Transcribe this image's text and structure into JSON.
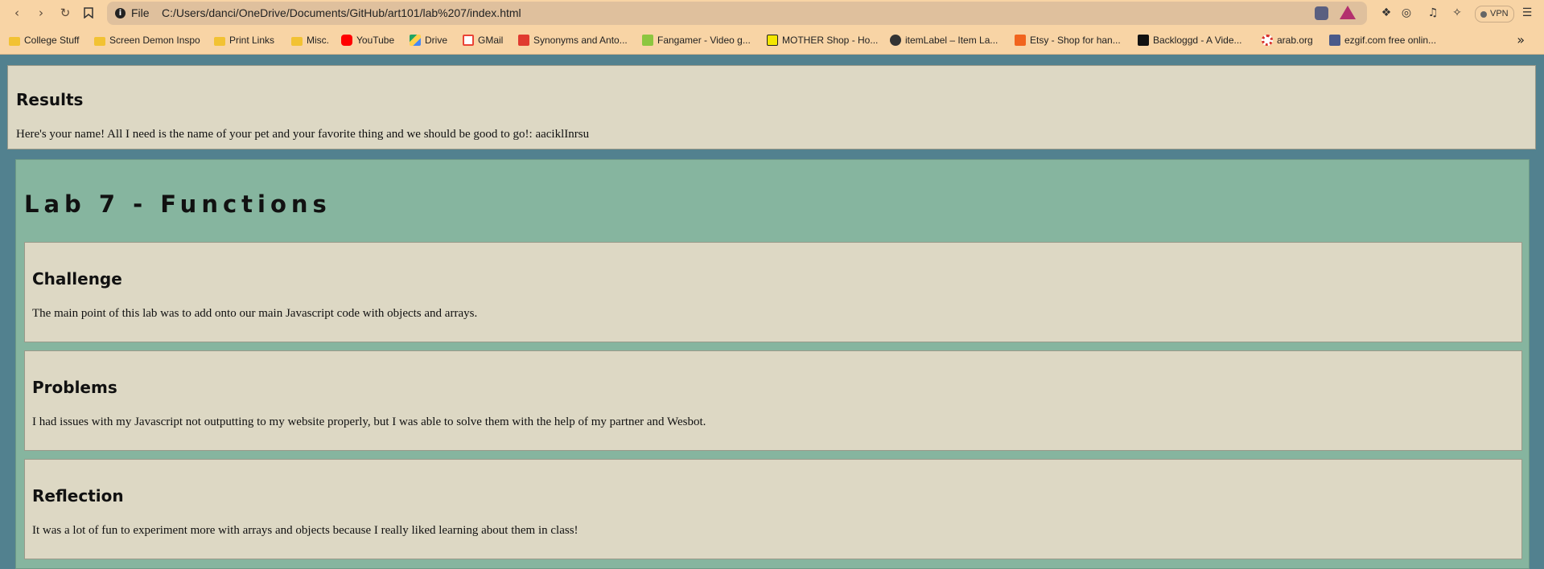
{
  "browser": {
    "file_label": "File",
    "url": "C:/Users/danci/OneDrive/Documents/GitHub/art101/lab%207/index.html",
    "vpn_label": "VPN"
  },
  "bookmarks": [
    {
      "label": "College Stuff",
      "icon": "folder-icon",
      "color": "#f2c233"
    },
    {
      "label": "Screen Demon Inspo",
      "icon": "folder-icon",
      "color": "#f2c233"
    },
    {
      "label": "Print Links",
      "icon": "folder-icon",
      "color": "#f2c233"
    },
    {
      "label": "Misc.",
      "icon": "folder-icon",
      "color": "#f2c233"
    },
    {
      "label": "YouTube",
      "icon": "youtube-icon",
      "color": "#ff0000"
    },
    {
      "label": "Drive",
      "icon": "drive-icon",
      "color": "#1fa463"
    },
    {
      "label": "GMail",
      "icon": "gmail-icon",
      "color": "#ea4335"
    },
    {
      "label": "Synonyms and Anto...",
      "icon": "thesaurus-icon",
      "color": "#e03a2f"
    },
    {
      "label": "Fangamer - Video g...",
      "icon": "fangamer-icon",
      "color": "#8cc63f"
    },
    {
      "label": "MOTHER Shop - Ho...",
      "icon": "mother-icon",
      "color": "#f3e600"
    },
    {
      "label": "itemLabel – Item La...",
      "icon": "globe-icon",
      "color": "#333333"
    },
    {
      "label": "Etsy - Shop for han...",
      "icon": "etsy-icon",
      "color": "#f1641e"
    },
    {
      "label": "Backloggd - A Vide...",
      "icon": "backloggd-icon",
      "color": "#111111"
    },
    {
      "label": "arab.org",
      "icon": "arab-org-icon",
      "color": "#d8312d"
    },
    {
      "label": "ezgif.com free onlin...",
      "icon": "ezgif-icon",
      "color": "#4a5a8a"
    }
  ],
  "results": {
    "heading": "Results",
    "text": "Here's your name! All I need is the name of your pet and your favorite thing and we should be good to go!: aaciklInrsu"
  },
  "main": {
    "title": "Lab 7 - Functions",
    "sections": [
      {
        "heading": "Challenge",
        "text": "The main point of this lab was to add onto our main Javascript code with objects and arrays."
      },
      {
        "heading": "Problems",
        "text": "I had issues with my Javascript not outputting to my website properly, but I was able to solve them with the help of my partner and Wesbot."
      },
      {
        "heading": "Reflection",
        "text": "It was a lot of fun to experiment more with arrays and objects because I really liked learning about them in class!"
      }
    ]
  },
  "colors": {
    "page_bg": "#52818f",
    "main_bg": "#86b59f",
    "card_bg": "#ddd8c4",
    "chrome_bg": "#f8d4a5"
  }
}
